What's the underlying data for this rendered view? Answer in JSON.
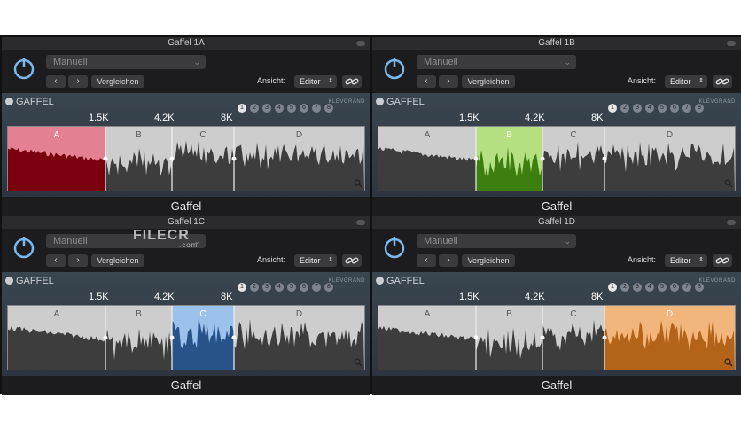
{
  "panels": [
    {
      "title": "Gaffel 1A",
      "active": 0,
      "color": "#7a0010",
      "accent": "#e38091"
    },
    {
      "title": "Gaffel 1B",
      "active": 1,
      "color": "#3c7f10",
      "accent": "#b4e082"
    },
    {
      "title": "Gaffel 1C",
      "active": 2,
      "color": "#28538a",
      "accent": "#9cc2ec"
    },
    {
      "title": "Gaffel 1D",
      "active": 3,
      "color": "#b46418",
      "accent": "#f2b67c"
    }
  ],
  "preset": "Manuell",
  "compare": "Vergleichen",
  "view_label": "Ansicht:",
  "view_value": "Editor",
  "logo": "GAFFEL",
  "brand": "KLEVGRÄND",
  "slots": [
    "1",
    "2",
    "3",
    "4",
    "5",
    "6",
    "7",
    "8"
  ],
  "freqs": [
    "1.5K",
    "4.2K",
    "8K"
  ],
  "bands": [
    "A",
    "B",
    "C",
    "D"
  ],
  "footer": "Gaffel",
  "watermark": {
    "brand": "FILECR",
    "sub": ".com"
  },
  "icons": {
    "power": "power-icon",
    "prev": "chevron-left-icon",
    "next": "chevron-right-icon",
    "link": "link-icon",
    "zoom": "magnifier-icon",
    "dropdown": "chevron-down-icon",
    "updown": "updown-icon"
  }
}
